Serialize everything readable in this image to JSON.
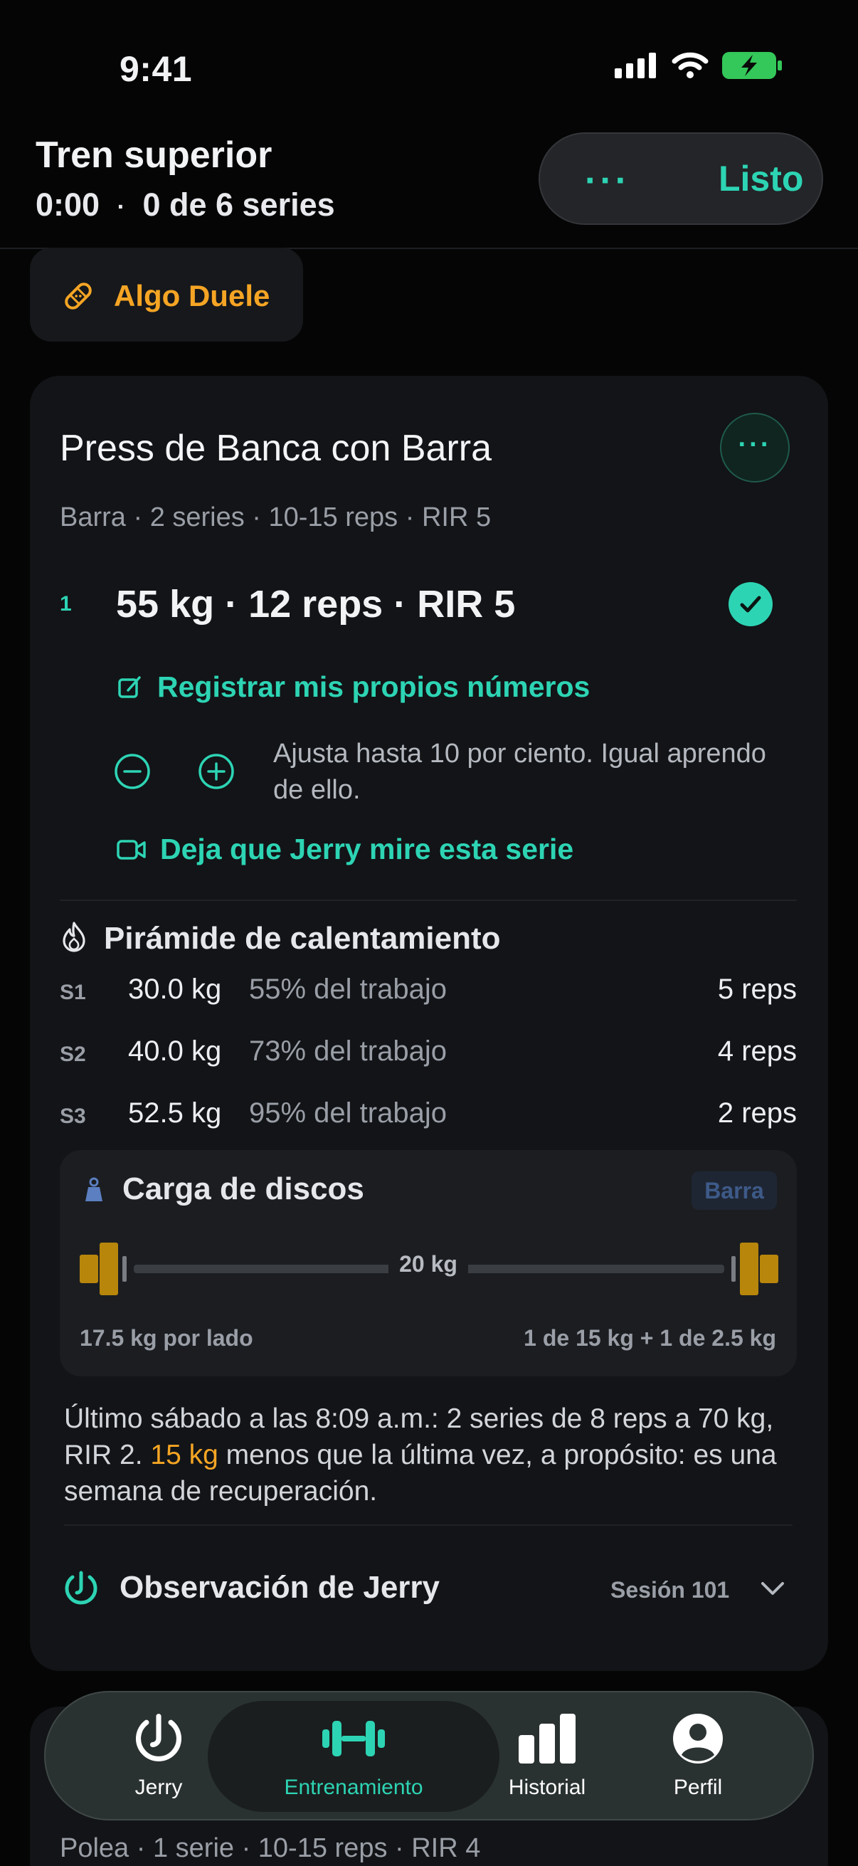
{
  "status": {
    "time": "9:41"
  },
  "header": {
    "title": "Tren superior",
    "elapsed": "0:00",
    "sep": "·",
    "progress": "0 de 6 series",
    "more_label": "···",
    "done_label": "Listo"
  },
  "hurt_button": {
    "label": "Algo Duele"
  },
  "exercise": {
    "title": "Press de Banca con Barra",
    "more_label": "···",
    "meta": "Barra · 2 series · 10-15 reps · RIR 5",
    "set": {
      "index": "1",
      "summary": "55 kg · 12 reps · RIR 5",
      "completed": true
    },
    "log_own_label": "Registrar mis propios números",
    "adjust_text": "Ajusta hasta 10 por ciento. Igual aprendo de ello.",
    "watch_label": "Deja que Jerry mire esta serie"
  },
  "warmup": {
    "title": "Pirámide de calentamiento",
    "rows": [
      {
        "label": "S1",
        "weight": "30.0 kg",
        "pct": "55% del trabajo",
        "reps": "5 reps"
      },
      {
        "label": "S2",
        "weight": "40.0 kg",
        "pct": "73% del trabajo",
        "reps": "4 reps"
      },
      {
        "label": "S3",
        "weight": "52.5 kg",
        "pct": "95% del trabajo",
        "reps": "2 reps"
      }
    ]
  },
  "plates": {
    "title": "Carga de discos",
    "badge": "Barra",
    "bar_weight": "20 kg",
    "per_side": "17.5 kg por lado",
    "breakdown": "1 de 15 kg + 1 de 2.5 kg"
  },
  "last_session": {
    "before": "Último sábado a las 8:09 a.m.: 2 series de 8 reps a 70 kg, RIR 2. ",
    "highlight": "15 kg",
    "after": " menos que la última vez, a propósito: es una semana de recuperación."
  },
  "observation": {
    "title": "Observación de Jerry",
    "session": "Sesión 101"
  },
  "next_card": {
    "meta": "Polea · 1 serie · 10-15 reps · RIR 4"
  },
  "tabs": [
    {
      "label": "Jerry",
      "icon": "jerry-logo-icon"
    },
    {
      "label": "Entrenamiento",
      "icon": "dumbbell-icon"
    },
    {
      "label": "Historial",
      "icon": "bar-chart-icon"
    },
    {
      "label": "Perfil",
      "icon": "person-icon"
    }
  ],
  "colors": {
    "accent": "#2dd4b4",
    "warning": "#f5a524",
    "plate": "#b8860b"
  }
}
